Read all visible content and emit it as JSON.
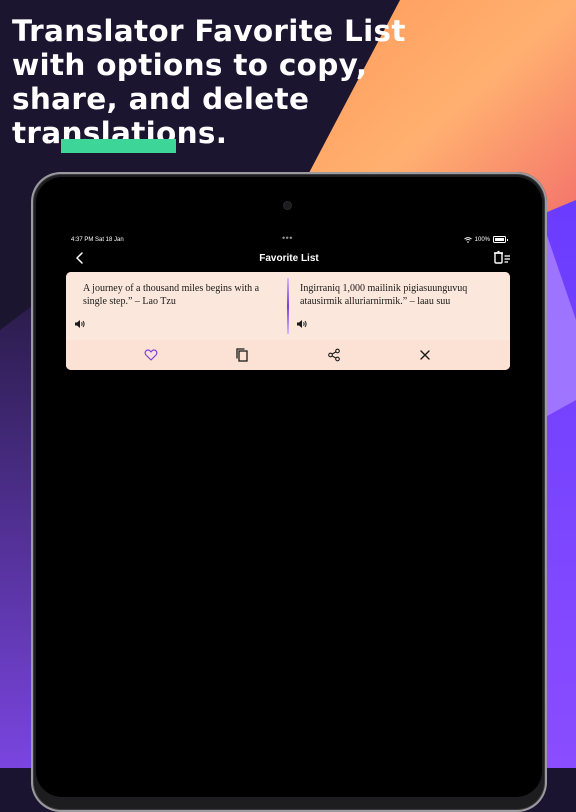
{
  "promo": {
    "headline": "Translator Favorite List with options to copy, share, and delete translations.",
    "accent_color": "#3ed598"
  },
  "status_bar": {
    "time_date": "4:37 PM  Sat 18 Jan",
    "battery": "100%"
  },
  "nav": {
    "title": "Favorite List",
    "back_icon": "chevron-left-icon",
    "delete_icon": "delete-list-icon"
  },
  "favorites": [
    {
      "source_text": "A journey of a thousand miles begins with a single step.” – Lao Tzu",
      "translated_text": "Ingirraniq 1,000 mailinik pigiasuunguvuq atausirmik alluriarnirmik.” – laau suu",
      "actions": [
        "heart-icon",
        "copy-icon",
        "share-icon",
        "close-icon"
      ]
    }
  ],
  "colors": {
    "card_background": "#fbe4d8",
    "heart": "#7b3fd9",
    "divider": "#7b3fd9"
  }
}
